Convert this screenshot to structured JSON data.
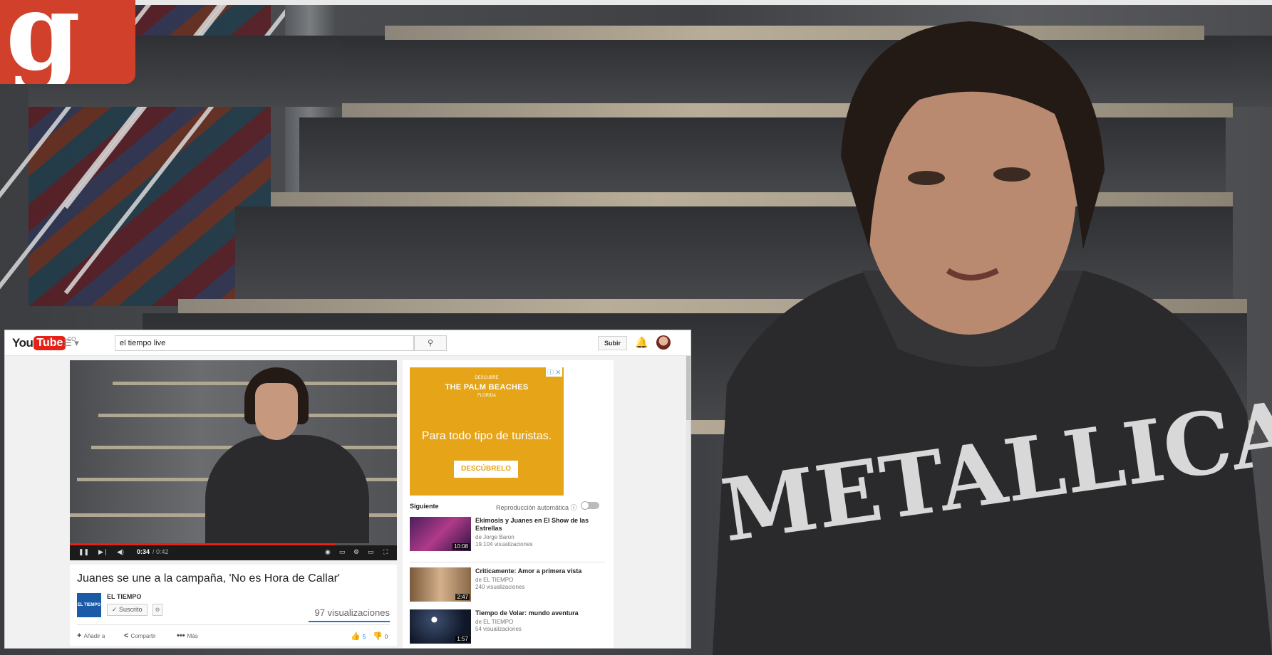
{
  "youtube": {
    "logo_you": "You",
    "logo_tube": "Tube",
    "logo_country": "CO",
    "search_query": "el tiempo live",
    "upload_label": "Subir",
    "player": {
      "time_current": "0:34",
      "time_total": "/ 0:42",
      "progress_fraction": 0.81
    },
    "video": {
      "title": "Juanes se une a la campaña, 'No es Hora de Callar'",
      "channel_name": "EL TIEMPO",
      "channel_thumb_text": "EL TIEMPO",
      "subscribed_label": "Suscrito",
      "views": "97 visualizaciones",
      "actions": {
        "add_label": "Añadir a",
        "share_label": "Compartir",
        "more_label": "Más",
        "likes": "5",
        "dislikes": "0"
      }
    },
    "sidebar": {
      "ad": {
        "brand_pre": "DESCUBRE",
        "brand": "THE PALM BEACHES",
        "brand_post": "FLORIDA",
        "tagline": "Para todo tipo de turistas.",
        "cta": "DESCÚBRELO"
      },
      "next_label": "Siguiente",
      "autoplay_label": "Reproducción automática",
      "recommendations": [
        {
          "title": "Ekimosis y Juanes en El Show de las Estrellas",
          "channel": "de Jorge Baron",
          "views": "19.104 visualizaciones",
          "duration": "10:08"
        },
        {
          "title": "Criticamente: Amor a primera vista",
          "channel": "de EL TIEMPO",
          "views": "240 visualizaciones",
          "duration": "2:47"
        },
        {
          "title": "Tiempo de Volar: mundo aventura",
          "channel": "de EL TIEMPO",
          "views": "54 visualizaciones",
          "duration": "1:57"
        }
      ]
    }
  },
  "colors": {
    "youtube_red": "#e62117",
    "google_plus_red": "#d0402a",
    "ad_orange": "#e6a418",
    "link_blue": "#167ac6"
  }
}
